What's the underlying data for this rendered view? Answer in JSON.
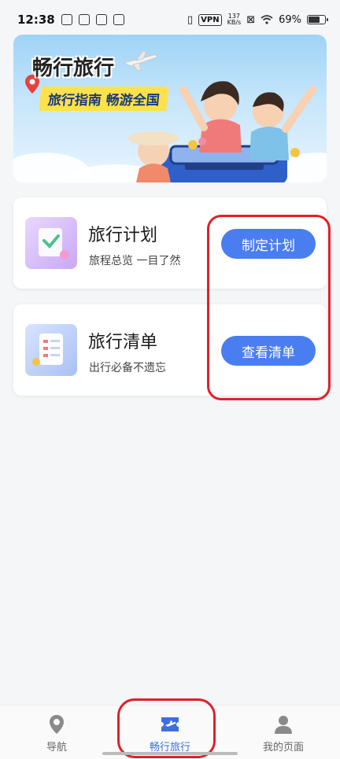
{
  "status_bar": {
    "time": "12:38",
    "vpn": "VPN",
    "net_speed_value": "137",
    "net_speed_unit": "KB/s",
    "battery": "69%"
  },
  "banner": {
    "title": "畅行旅行",
    "subtitle": "旅行指南 畅游全国"
  },
  "cards": [
    {
      "title": "旅行计划",
      "desc": "旅程总览 一目了然",
      "button": "制定计划",
      "icon": "document-check-icon"
    },
    {
      "title": "旅行清单",
      "desc": "出行必备不遗忘",
      "button": "查看清单",
      "icon": "checklist-icon"
    }
  ],
  "tabbar": {
    "items": [
      {
        "label": "导航",
        "icon": "location-pin-icon",
        "active": false
      },
      {
        "label": "畅行旅行",
        "icon": "ticket-plane-icon",
        "active": true
      },
      {
        "label": "我的页面",
        "icon": "user-icon",
        "active": false
      }
    ]
  },
  "colors": {
    "accent": "#4a7ef0",
    "active_tab": "#3d6fe0",
    "annotation": "#e0202a",
    "banner_tag": "#ffe14d"
  }
}
